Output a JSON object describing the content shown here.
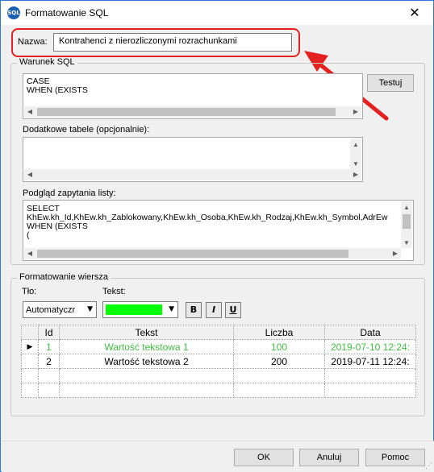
{
  "window": {
    "title": "Formatowanie SQL",
    "app_icon_text": "SQL"
  },
  "nazwa": {
    "label": "Nazwa:",
    "value": "Kontrahenci z nierozliczonymi rozrachunkami"
  },
  "warunek": {
    "group_title": "Warunek SQL",
    "text": "CASE\nWHEN (EXISTS",
    "test_button": "Testuj",
    "dodatkowe_label": "Dodatkowe tabele (opcjonalnie):",
    "dodatkowe_text": "",
    "podglad_label": "Podgląd zapytania listy:",
    "podglad_text": "SELECT\nKhEw.kh_Id,KhEw.kh_Zablokowany,KhEw.kh_Osoba,KhEw.kh_Rodzaj,KhEw.kh_Symbol,AdrEw\nWHEN (EXISTS\n("
  },
  "formatowanie": {
    "group_title": "Formatowanie wiersza",
    "tlo_label": "Tło:",
    "tlo_value": "Automatyczr",
    "tekst_label": "Tekst:",
    "tekst_color": "#00ff00",
    "bold_label": "B",
    "italic_label": "I",
    "underline_label": "U"
  },
  "grid": {
    "columns": [
      "Id",
      "Tekst",
      "Liczba",
      "Data"
    ],
    "rows": [
      {
        "id": "1",
        "tekst": "Wartość tekstowa 1",
        "liczba": "100",
        "data": "2019-07-10 12:24:",
        "current": true,
        "highlight": true
      },
      {
        "id": "2",
        "tekst": "Wartość tekstowa 2",
        "liczba": "200",
        "data": "2019-07-11 12:24:",
        "current": false,
        "highlight": false
      }
    ]
  },
  "buttons": {
    "ok": "OK",
    "anuluj": "Anuluj",
    "pomoc": "Pomoc"
  },
  "colors": {
    "highlight_border": "#e52020",
    "green_text": "#3fbf3f"
  }
}
